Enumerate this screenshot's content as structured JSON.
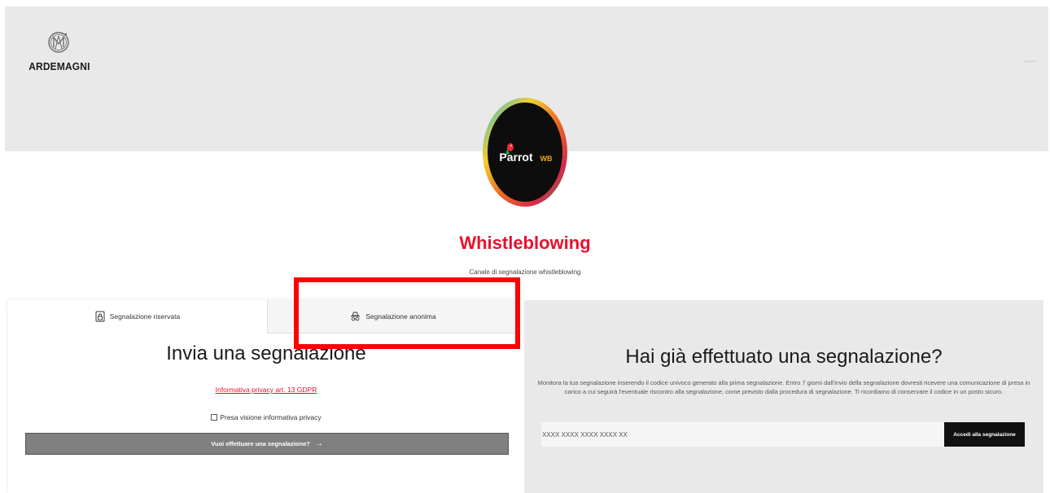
{
  "header": {
    "logo_text": "ARDEMAGNI",
    "badge_text": "Parrot",
    "badge_suffix": "WB"
  },
  "hero": {
    "title": "Whistleblowing",
    "subtitle": "Canale di segnalazione whistleblowing"
  },
  "left_panel": {
    "tabs": [
      {
        "label": "Segnalazione riservata",
        "icon": "lock-document-icon",
        "active": true
      },
      {
        "label": "Segnalazione anonima",
        "icon": "incognito-icon",
        "active": false
      }
    ],
    "heading": "Invia una segnalazione",
    "privacy_link": "Informativa privacy art. 13 GDPR",
    "privacy_checkbox_label": "Presa visione informativa privacy",
    "privacy_checked": false,
    "submit_label": "Vuoi effettuare una segnalazione?",
    "submit_arrow": "→"
  },
  "right_panel": {
    "heading": "Hai già effettuato una segnalazione?",
    "description": "Monitora la tua segnalazione inserendo il codice univoco generato alla prima segnalazione. Entro 7 giorni dall'invio della segnalazione dovresti ricevere una comunicazione di presa in carico a cui seguirà l'eventuale riscontro alla segnalazione, come previsto dalla procedura di segnalazione. Ti ricordiamo di conservare il codice in un posto sicuro.",
    "code_placeholder": "XXXX XXXX XXXX XXXX XX",
    "access_label": "Accedi alla segnalazione"
  },
  "colors": {
    "accent_red": "#e8112d",
    "header_bg": "#e9e9e9",
    "button_gray": "#808080",
    "button_black": "#111111",
    "annotation_red": "#ff0000"
  }
}
